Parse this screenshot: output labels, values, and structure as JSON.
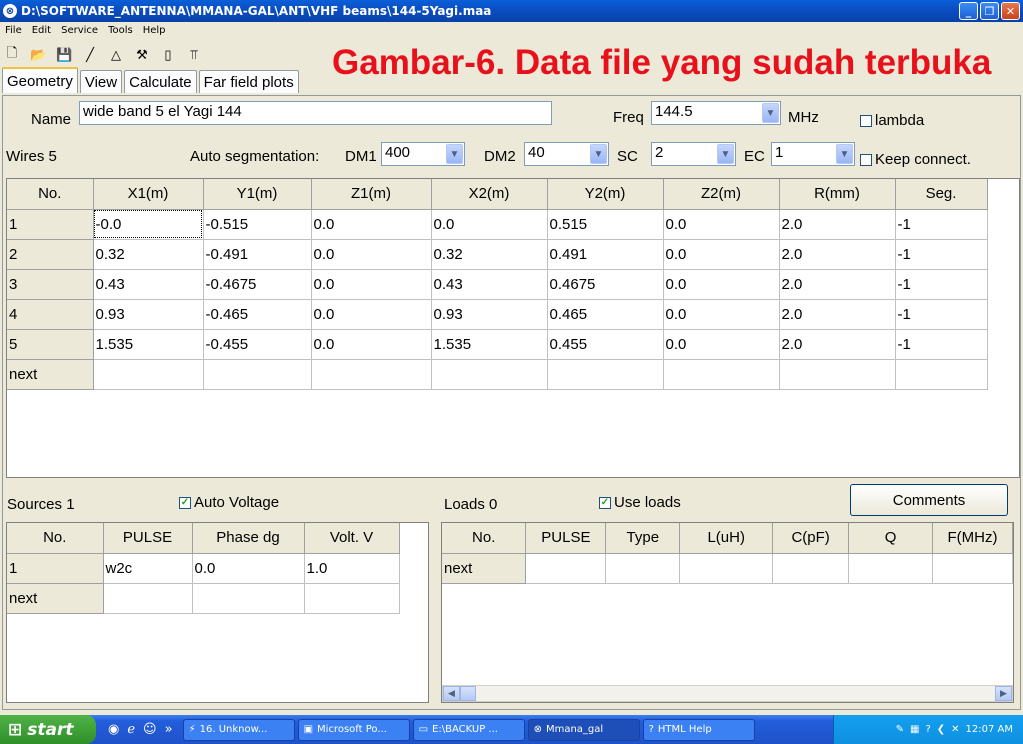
{
  "window": {
    "title": "D:\\SOFTWARE_ANTENNA\\MMANA-GAL\\ANT\\VHF beams\\144-5Yagi.maa",
    "minimize": "_",
    "maximize": "❐",
    "close": "✕"
  },
  "menu": [
    "File",
    "Edit",
    "Service",
    "Tools",
    "Help"
  ],
  "heading": "Gambar-6. Data file yang sudah terbuka",
  "tabs": [
    "Geometry",
    "View",
    "Calculate",
    "Far field plots"
  ],
  "geometry": {
    "name_label": "Name",
    "name_value": "wide band 5 el Yagi 144",
    "freq_label": "Freq",
    "freq_value": "144.5",
    "freq_unit": "MHz",
    "lambda_label": "lambda",
    "wires_label": "Wires 5",
    "auto_seg_label": "Auto segmentation:",
    "dm1_label": "DM1",
    "dm1_value": "400",
    "dm2_label": "DM2",
    "dm2_value": "40",
    "sc_label": "SC",
    "sc_value": "2",
    "ec_label": "EC",
    "ec_value": "1",
    "keep_connect_label": "Keep connect.",
    "wires_table": {
      "headers": [
        "No.",
        "X1(m)",
        "Y1(m)",
        "Z1(m)",
        "X2(m)",
        "Y2(m)",
        "Z2(m)",
        "R(mm)",
        "Seg."
      ],
      "rows": [
        [
          "1",
          "-0.0",
          "-0.515",
          "0.0",
          "0.0",
          "0.515",
          "0.0",
          "2.0",
          "-1"
        ],
        [
          "2",
          "0.32",
          "-0.491",
          "0.0",
          "0.32",
          "0.491",
          "0.0",
          "2.0",
          "-1"
        ],
        [
          "3",
          "0.43",
          "-0.4675",
          "0.0",
          "0.43",
          "0.4675",
          "0.0",
          "2.0",
          "-1"
        ],
        [
          "4",
          "0.93",
          "-0.465",
          "0.0",
          "0.93",
          "0.465",
          "0.0",
          "2.0",
          "-1"
        ],
        [
          "5",
          "1.535",
          "-0.455",
          "0.0",
          "1.535",
          "0.455",
          "0.0",
          "2.0",
          "-1"
        ],
        [
          "next",
          "",
          "",
          "",
          "",
          "",
          "",
          "",
          ""
        ]
      ]
    },
    "sources_label": "Sources 1",
    "auto_voltage_label": "Auto Voltage",
    "auto_voltage_checked": true,
    "sources_table": {
      "headers": [
        "No.",
        "PULSE",
        "Phase dg",
        "Volt. V"
      ],
      "rows": [
        [
          "1",
          "w2c",
          "0.0",
          "1.0"
        ],
        [
          "next",
          "",
          "",
          ""
        ]
      ]
    },
    "loads_label": "Loads 0",
    "use_loads_label": "Use loads",
    "use_loads_checked": true,
    "comments_label": "Comments",
    "loads_table": {
      "headers": [
        "No.",
        "PULSE",
        "Type",
        "L(uH)",
        "C(pF)",
        "Q",
        "F(MHz)"
      ],
      "rows": [
        [
          "next",
          "",
          "",
          "",
          "",
          "",
          ""
        ]
      ]
    }
  },
  "taskbar": {
    "start_label": "start",
    "tasks": [
      "16. Unknow...",
      "Microsoft Po...",
      "E:\\BACKUP ...",
      "Mmana_gal",
      "HTML Help"
    ],
    "clock": "12:07 AM"
  }
}
